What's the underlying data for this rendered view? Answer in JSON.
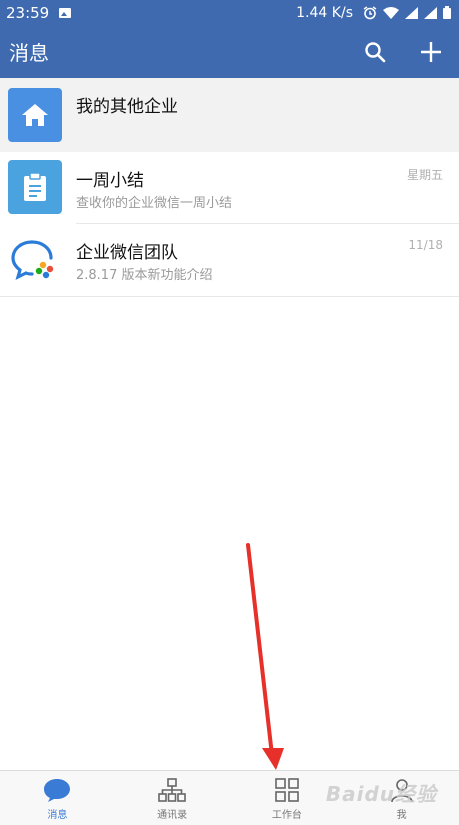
{
  "status_bar": {
    "time": "23:59",
    "network_speed": "1.44 K/s"
  },
  "header": {
    "title": "消息"
  },
  "conversations": [
    {
      "name": "我的其他企业",
      "subtitle": "",
      "time": "",
      "avatar_icon": "house-icon",
      "avatar_color": "#4a90e2"
    },
    {
      "name": "一周小结",
      "subtitle": "查收你的企业微信一周小结",
      "time": "星期五",
      "avatar_icon": "clipboard-icon",
      "avatar_color": "#4aa3df"
    },
    {
      "name": "企业微信团队",
      "subtitle": "2.8.17 版本新功能介绍",
      "time": "11/18",
      "avatar_icon": "wecom-logo-icon",
      "avatar_color": "#ffffff"
    }
  ],
  "tabs": [
    {
      "label": "消息",
      "icon": "chat-bubble-icon",
      "active": true
    },
    {
      "label": "通讯录",
      "icon": "org-chart-icon",
      "active": false
    },
    {
      "label": "工作台",
      "icon": "grid-icon",
      "active": false
    },
    {
      "label": "我",
      "icon": "person-icon",
      "active": false
    }
  ],
  "watermark": "Baidu经验",
  "colors": {
    "primary": "#3f6ab0",
    "tab_active": "#3a7bd5",
    "annotation_arrow": "#e8302a"
  }
}
